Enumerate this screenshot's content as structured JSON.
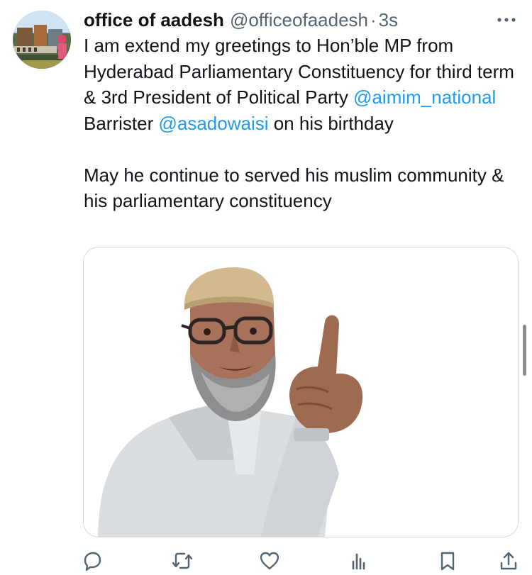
{
  "tweet": {
    "display_name": "office of aadesh",
    "handle": "@officeofaadesh",
    "separator": "·",
    "timestamp": "3s",
    "body": {
      "p1_part1": "I am extend my greetings to Hon’ble MP from Hyderabad Parliamentary Constituency for third term & 3rd President of Political Party ",
      "mention1": "@aimim_national",
      "p1_part2": " Barrister ",
      "mention2": "@asadowaisi",
      "p1_part3": " on his birthday",
      "p2": "May he continue to served his muslim community & his parliamentary constituency"
    },
    "media": {
      "image_alt": "photo-of-man-pointing-finger"
    }
  },
  "icons": {
    "avatar": "profile-avatar",
    "more": "more-options-icon",
    "reply": "reply-icon",
    "retweet": "retweet-icon",
    "like": "like-icon",
    "views": "views-icon",
    "bookmark": "bookmark-icon",
    "share": "share-icon"
  },
  "colors": {
    "text": "#0f1419",
    "secondary": "#536471",
    "link": "#1d9bf0",
    "border": "#cfd9de"
  }
}
